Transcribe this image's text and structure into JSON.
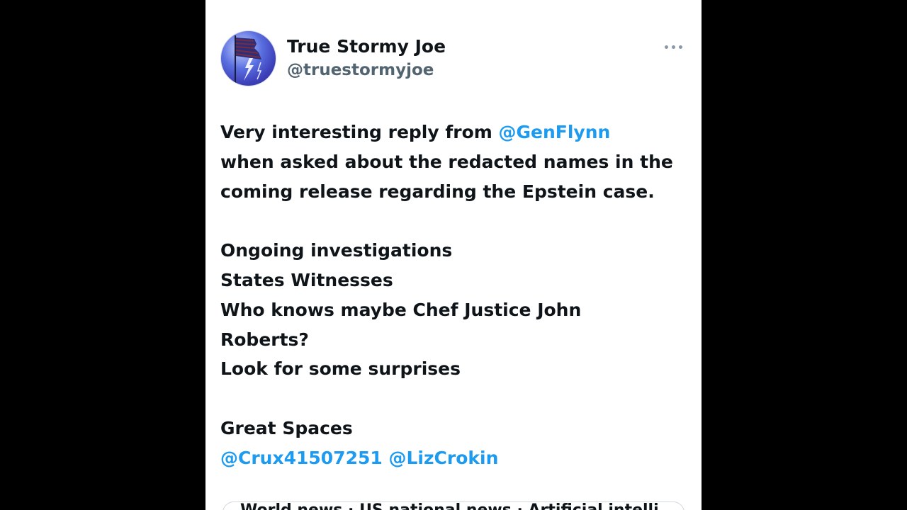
{
  "tweet": {
    "display_name": "True Stormy Joe",
    "handle": "@truestormyjoe",
    "more_icon": "more-horizontal-icon",
    "avatar_icon": "flag-lightning-avatar",
    "lines": {
      "l1_text": "Very interesting reply from ",
      "l1_mention": "@GenFlynn",
      "l2": "when asked about the redacted names in the",
      "l3": "coming release regarding the Epstein case.",
      "l4": "Ongoing investigations",
      "l5": "States Witnesses",
      "l6": "Who knows maybe Chef Justice John",
      "l7": "Roberts?",
      "l8": "Look for some surprises",
      "l9": "Great Spaces",
      "l10_mention_1": "@Crux41507251",
      "l10_mention_2": "@LizCrokin"
    },
    "link_preview_text": "World news · US national news · Artificial intelli"
  },
  "colors": {
    "background": "#000000",
    "card": "#ffffff",
    "text": "#0f1419",
    "secondary": "#536471",
    "mention": "#1d9bf0"
  }
}
